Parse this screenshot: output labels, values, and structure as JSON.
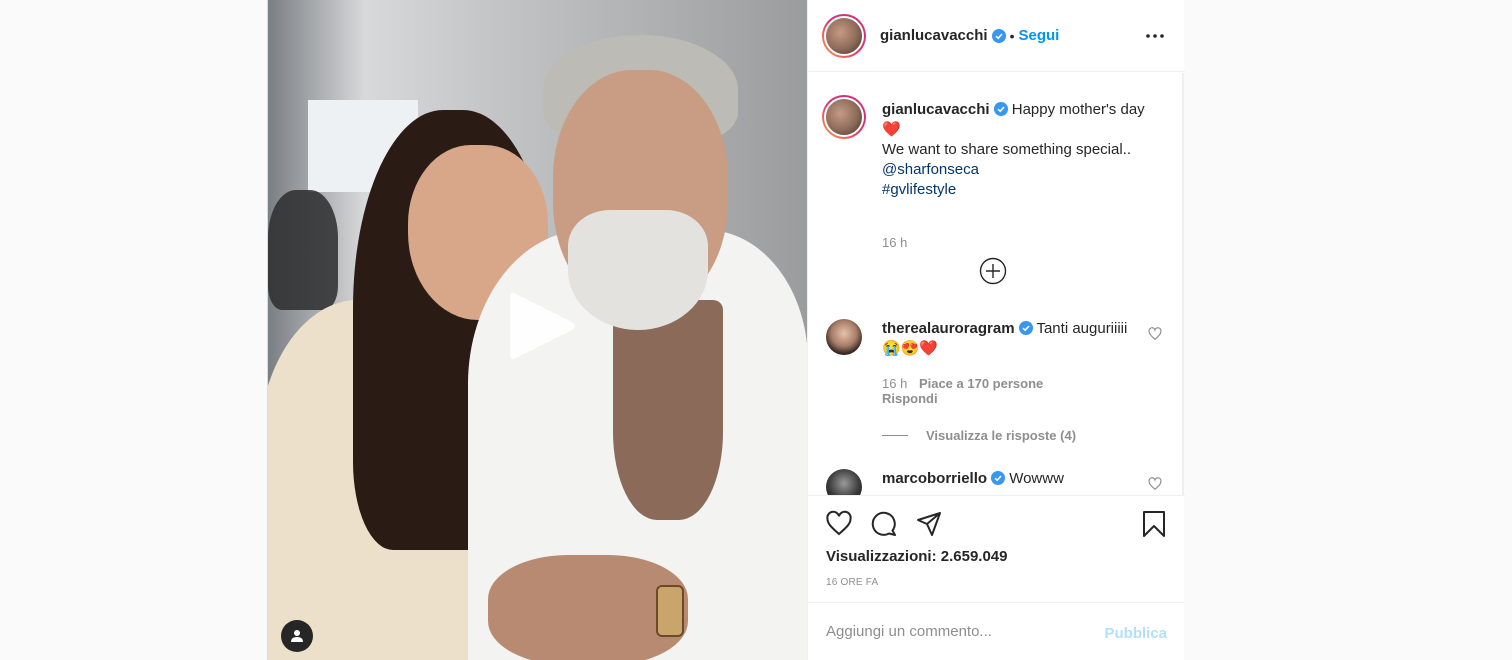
{
  "post": {
    "author": "gianlucavacchi",
    "follow_label": "Segui",
    "separator": "•",
    "caption": {
      "username": "gianlucavacchi",
      "line1": "Happy mother's day",
      "line2_emoji": "❤️",
      "line3": "We want to share something special..",
      "mention": "@sharfonseca",
      "hashtag": "#gvlifestyle",
      "time": "16 h"
    },
    "comments": [
      {
        "username": "therealauroragram",
        "text": "Tanti auguriiiii",
        "emojis": "😭😍❤️",
        "time": "16 h",
        "likes": "Piace a 170 persone",
        "reply_label": "Rispondi",
        "view_replies": "Visualizza le risposte (4)"
      },
      {
        "username": "marcoborriello",
        "text": "Wowww"
      }
    ],
    "views_label": "Visualizzazioni:",
    "views_count": "2.659.049",
    "time_ago": "16 ORE FA",
    "comment_placeholder": "Aggiungi un commento...",
    "publish_label": "Pubblica"
  },
  "colors": {
    "accent": "#0095f6",
    "link": "#00376b",
    "verified": "#3897f0",
    "muted": "#8e8e8e",
    "heart": "#ed4956"
  },
  "icons": [
    "play-icon",
    "user-tag-icon",
    "more-icon",
    "verified-icon",
    "add-circle-icon",
    "heart-icon",
    "comment-icon",
    "share-icon",
    "bookmark-icon"
  ]
}
